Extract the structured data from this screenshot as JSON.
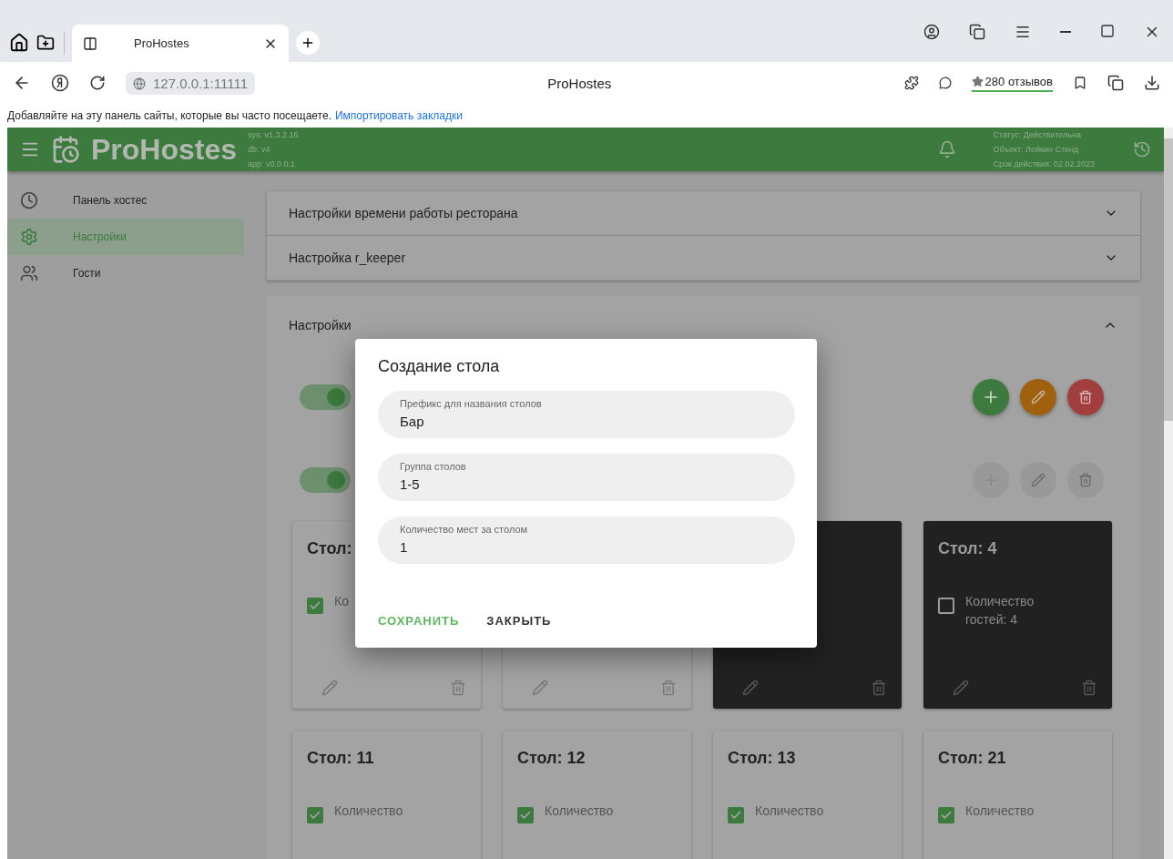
{
  "browser": {
    "tabs": [
      {
        "title": "ProHostes",
        "selected": true
      }
    ],
    "address": "127.0.0.1:11111",
    "page_title": "ProHostes",
    "reviews": "280 отзывов",
    "bookmarks_hint": "Добавляйте на эту панель сайты, которые вы часто посещаете.",
    "bookmarks_link": "Импортировать закладки"
  },
  "header": {
    "brand": "ProHostes",
    "versions": [
      "sys: v1.3.2.16",
      "db: v4",
      "app: v0.0.0.1"
    ],
    "status": [
      "Статус: Действительна",
      "Объект: Лейкин Стенд",
      "Срок действия: 02.02.2023"
    ]
  },
  "sidebar": {
    "items": [
      {
        "label": "Панель хостес",
        "kind": "clock",
        "selected": false
      },
      {
        "label": "Настройки",
        "kind": "gear",
        "selected": true
      },
      {
        "label": "Гости",
        "kind": "people",
        "selected": false
      }
    ]
  },
  "accordions": [
    {
      "title": "Настройки времени работы ресторана",
      "expanded": false
    },
    {
      "title": "Настройка r_keeper",
      "expanded": false
    },
    {
      "title": "Настройки",
      "expanded": true
    }
  ],
  "toggles": [
    {
      "on": true,
      "actions_disabled": false
    },
    {
      "on": true,
      "actions_disabled": true
    }
  ],
  "tables": [
    {
      "title": "Стол:",
      "line1": "Ко",
      "checked": true,
      "dark": false
    },
    {
      "dark": false
    },
    {
      "dark": true
    },
    {
      "title": "Стол: 4",
      "line1": "Количество",
      "line2": "гостей: 4",
      "checked": false,
      "dark": true
    },
    {
      "title": "Стол: 11",
      "line1": "Количество",
      "checked": true,
      "dark": false
    },
    {
      "title": "Стол: 12",
      "line1": "Количество",
      "checked": true,
      "dark": false
    },
    {
      "title": "Стол: 13",
      "line1": "Количество",
      "checked": true,
      "dark": false
    },
    {
      "title": "Стол: 21",
      "line1": "Количество",
      "checked": true,
      "dark": false
    }
  ],
  "dialog": {
    "title": "Создание стола",
    "fields": [
      {
        "label": "Префикс для названия столов",
        "value": "Бар"
      },
      {
        "label": "Группа столов",
        "value": "1-5"
      },
      {
        "label": "Количество мест за столом",
        "value": "1"
      }
    ],
    "buttons": [
      {
        "label": "СОХРАНИТЬ",
        "kind": "primary"
      },
      {
        "label": "ЗАКРЫТЬ",
        "kind": "plain"
      }
    ]
  }
}
